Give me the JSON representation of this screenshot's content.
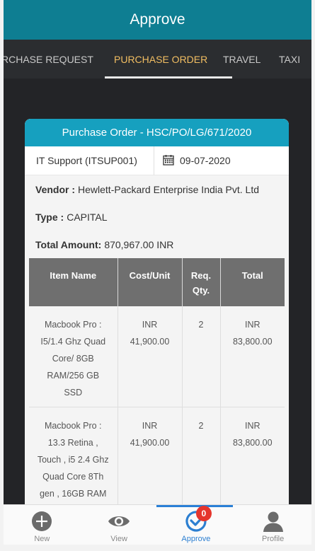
{
  "header": {
    "title": "Approve"
  },
  "tabs": [
    {
      "label": "RCHASE REQUEST",
      "active": false
    },
    {
      "label": "PURCHASE ORDER",
      "active": true
    },
    {
      "label": "TRAVEL",
      "active": false
    },
    {
      "label": "TAXI",
      "active": false
    }
  ],
  "card": {
    "title": "Purchase Order - HSC/PO/LG/671/2020",
    "department": "IT Support (ITSUP001)",
    "date": "09-07-2020",
    "vendor_label": "Vendor :",
    "vendor_value": "Hewlett-Packard Enterprise India Pvt. Ltd",
    "type_label": "Type :",
    "type_value": "CAPITAL",
    "amount_label": "Total Amount:",
    "amount_value": "870,967.00 INR",
    "table": {
      "headers": [
        "Item Name",
        "Cost/Unit",
        "Req.\nQty.",
        "Total"
      ],
      "rows": [
        [
          "Macbook Pro :\nI5/1.4 Ghz Quad\nCore/ 8GB\nRAM/256 GB\nSSD",
          "INR\n41,900.00",
          "2",
          "INR\n83,800.00"
        ],
        [
          "Macbook Pro :\n13.3 Retina ,\nTouch , i5 2.4 Ghz\nQuad Core 8Th\ngen , 16GB RAM",
          "INR\n41,900.00",
          "2",
          "INR\n83,800.00"
        ]
      ]
    }
  },
  "bottom_nav": {
    "items": [
      {
        "label": "New",
        "icon": "plus-circle-icon"
      },
      {
        "label": "View",
        "icon": "eye-icon"
      },
      {
        "label": "Approve",
        "icon": "check-circle-icon",
        "badge": "0",
        "active": true
      },
      {
        "label": "Profile",
        "icon": "user-icon"
      }
    ]
  },
  "colors": {
    "header": "#0e7e92",
    "card_header": "#16a0bf",
    "tab_active": "#f2be62",
    "nav_active": "#2c7fd1",
    "badge": "#e5352d"
  }
}
